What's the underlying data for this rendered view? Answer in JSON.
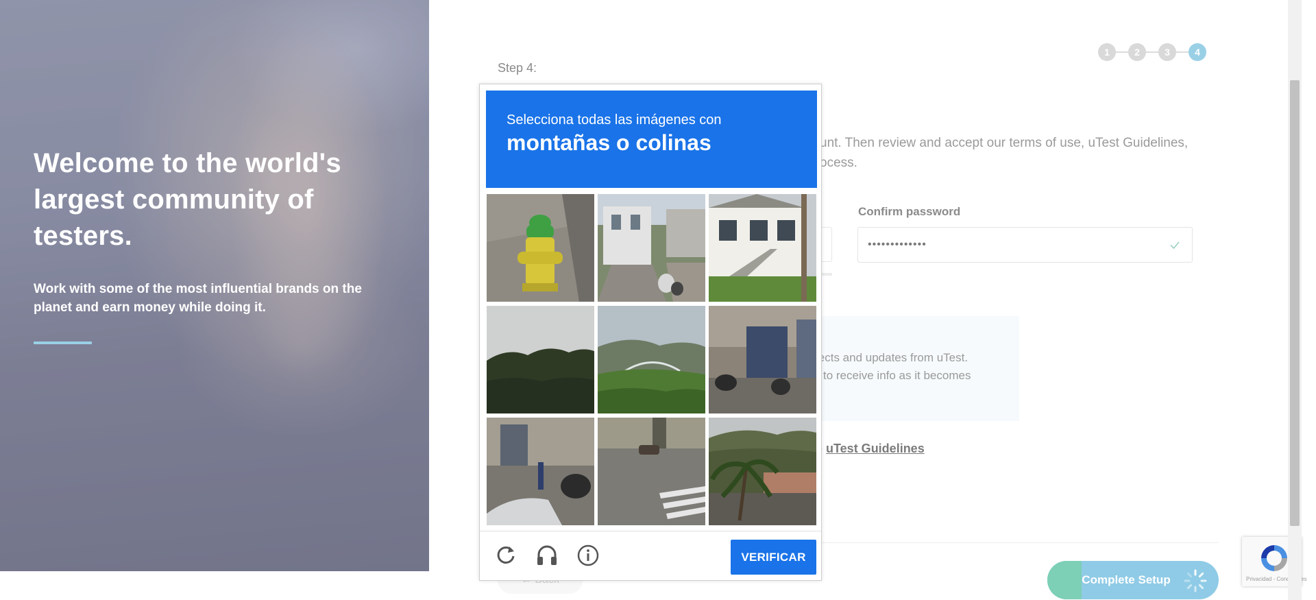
{
  "hero": {
    "title": "Welcome to the world's largest community of testers.",
    "subtitle": "Work with some of the most influential brands on the planet and earn money while doing it."
  },
  "signup": {
    "step_label": "Step 4:",
    "steps": [
      "1",
      "2",
      "3",
      "4"
    ],
    "active_step": 4,
    "intro_line1": "unt. Then review and accept our terms of use, uTest Guidelines,",
    "intro_line2": "ocess.",
    "confirm_password_label": "Confirm password",
    "confirm_password_value": "•••••••••••••",
    "newsletter_line1": "jects and updates from uTest.",
    "newsletter_line2": "to receive info as it becomes",
    "guidelines_prefix": "e ",
    "guidelines_link": "uTest Guidelines",
    "back_label": "← Back",
    "complete_label": "Complete Setup"
  },
  "captcha": {
    "instruction": "Selecciona todas las imágenes con",
    "target": "montañas o colinas",
    "verify_label": "VERIFICAR",
    "tiles": [
      "fire-hydrant",
      "house-steps-trash",
      "white-house-stairs",
      "trees-cloudy-sky",
      "hill-with-bridge",
      "street-motorbikes",
      "sidewalk-motorbikes-car",
      "crosswalk-street",
      "palm-tree-hill"
    ]
  },
  "recaptcha_badge": {
    "fine_print": "Privacidad - Condiciones"
  },
  "colors": {
    "captcha_blue": "#1a73e8",
    "step_active": "#9ad0e6",
    "complete_green": "#7dcfb6"
  }
}
